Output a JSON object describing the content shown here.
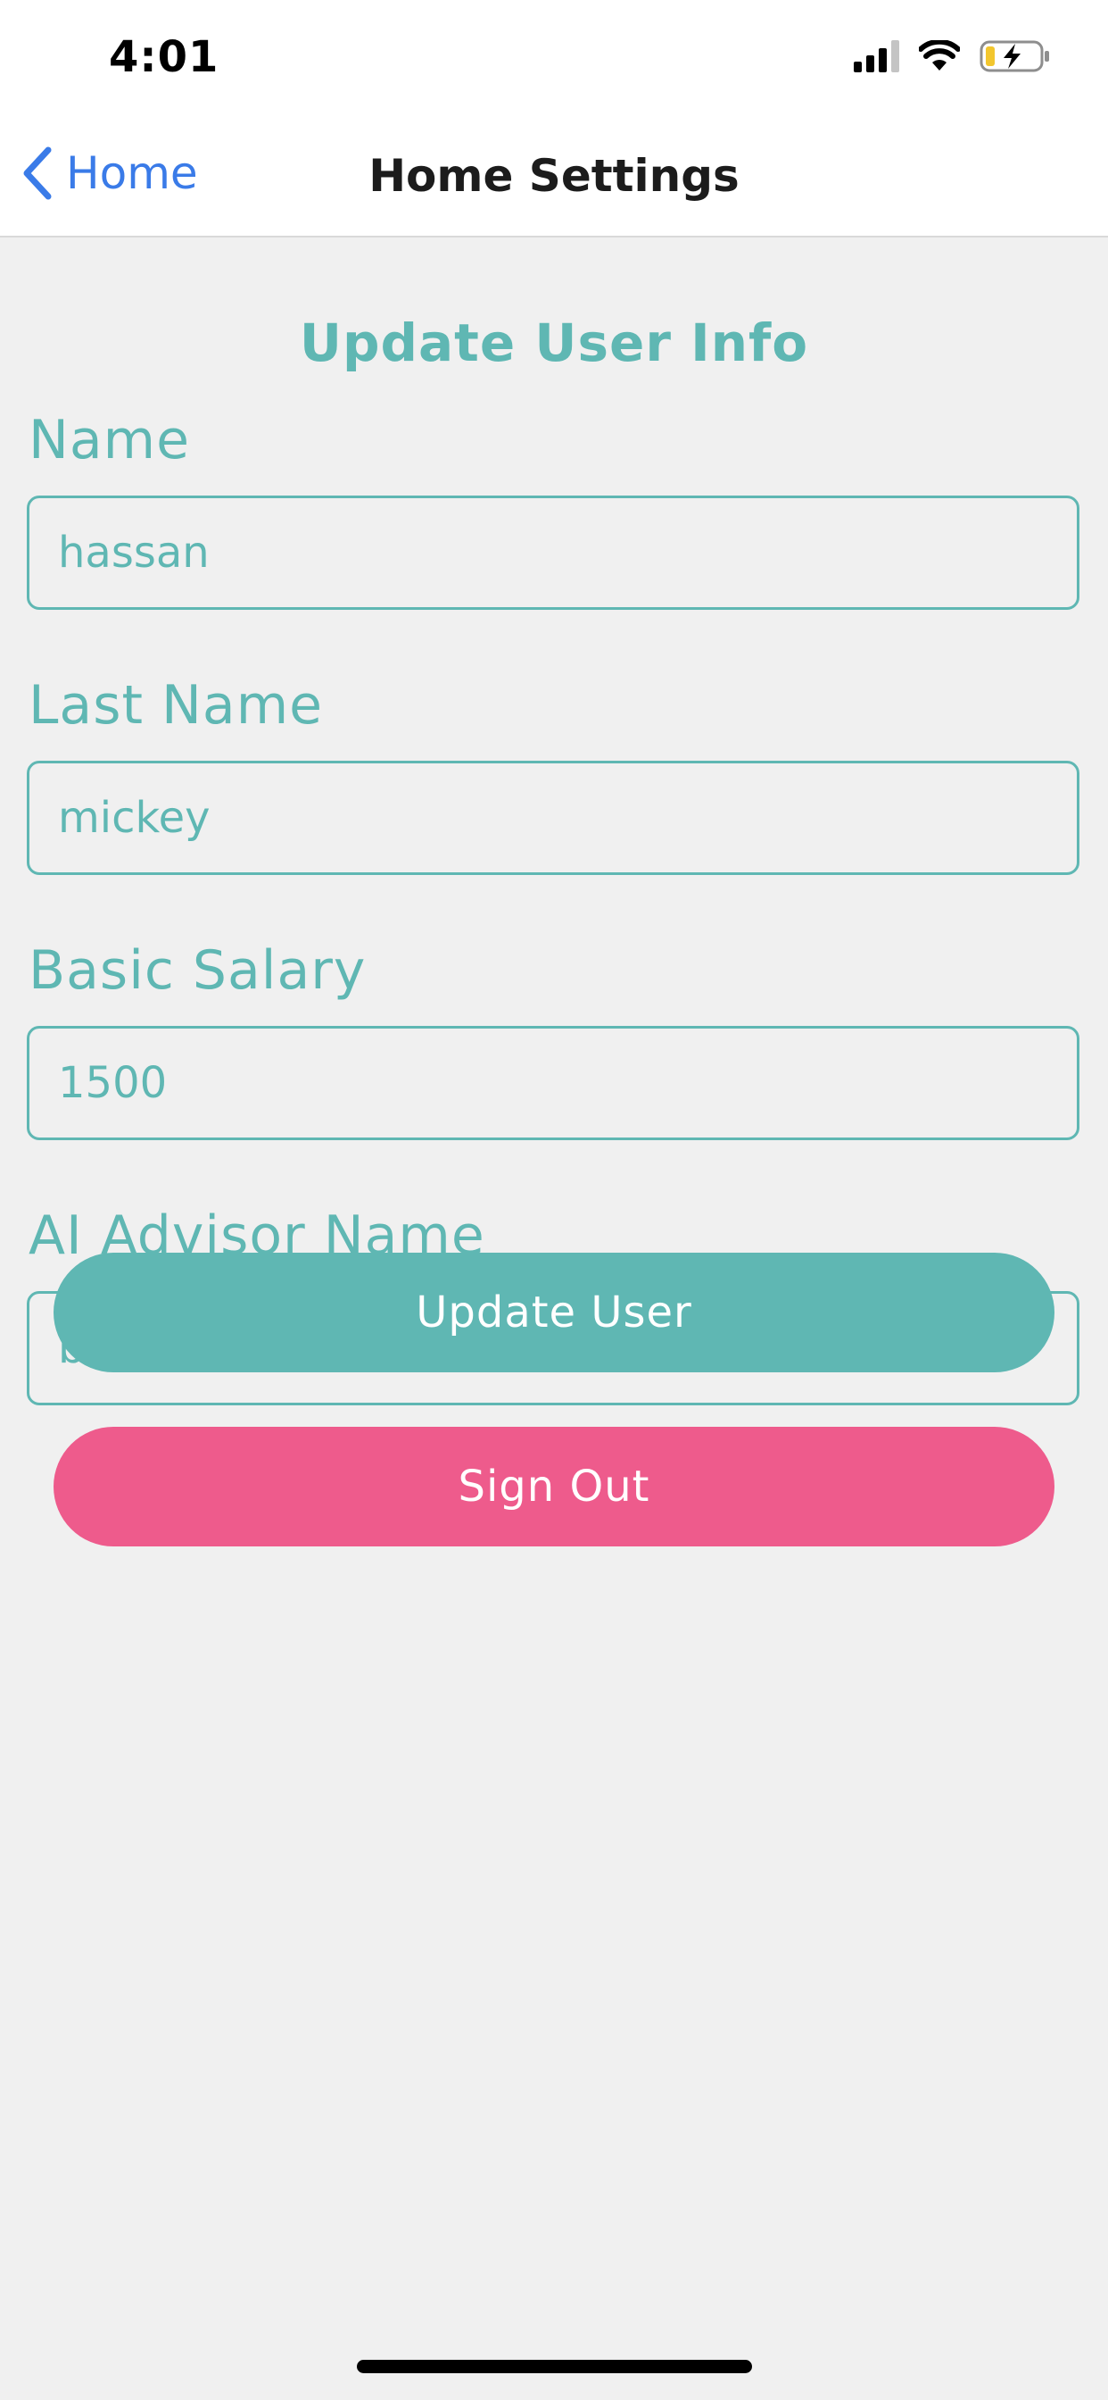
{
  "status_bar": {
    "time": "4:01"
  },
  "nav": {
    "back_label": "Home",
    "title": "Home Settings"
  },
  "form": {
    "title": "Update User Info",
    "fields": [
      {
        "label": "Name",
        "value": "hassan"
      },
      {
        "label": "Last Name",
        "value": "mickey"
      },
      {
        "label": "Basic Salary",
        "value": "1500"
      },
      {
        "label": "AI Advisor Name",
        "value": "bill gates"
      }
    ]
  },
  "buttons": {
    "update_label": "Update User",
    "signout_label": "Sign Out"
  },
  "colors": {
    "accent_teal": "#5fb7b3",
    "signout_pink": "#ee5b8c",
    "link_blue": "#3a7be8",
    "background": "#f0f0f0"
  }
}
